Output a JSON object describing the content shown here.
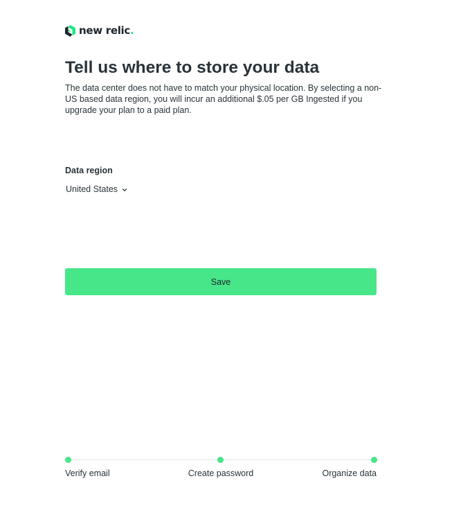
{
  "brand": {
    "name": "new relic",
    "dot": ".",
    "accent_color": "#1ce783",
    "logo_icon": "new-relic-logo-icon"
  },
  "page": {
    "title": "Tell us where to store your data",
    "description": "The data center does not have to match your physical location. By selecting a non-US based data region, you will incur an additional $.05 per GB Ingested if you upgrade your plan to a paid plan."
  },
  "region": {
    "label": "Data region",
    "selected": "United States",
    "icon": "chevron-down-icon"
  },
  "actions": {
    "save_label": "Save",
    "button_color": "#47e689"
  },
  "progress": {
    "steps": [
      {
        "label": "Verify email",
        "completed": true
      },
      {
        "label": "Create password",
        "completed": true
      },
      {
        "label": "Organize data",
        "completed": true
      }
    ]
  }
}
